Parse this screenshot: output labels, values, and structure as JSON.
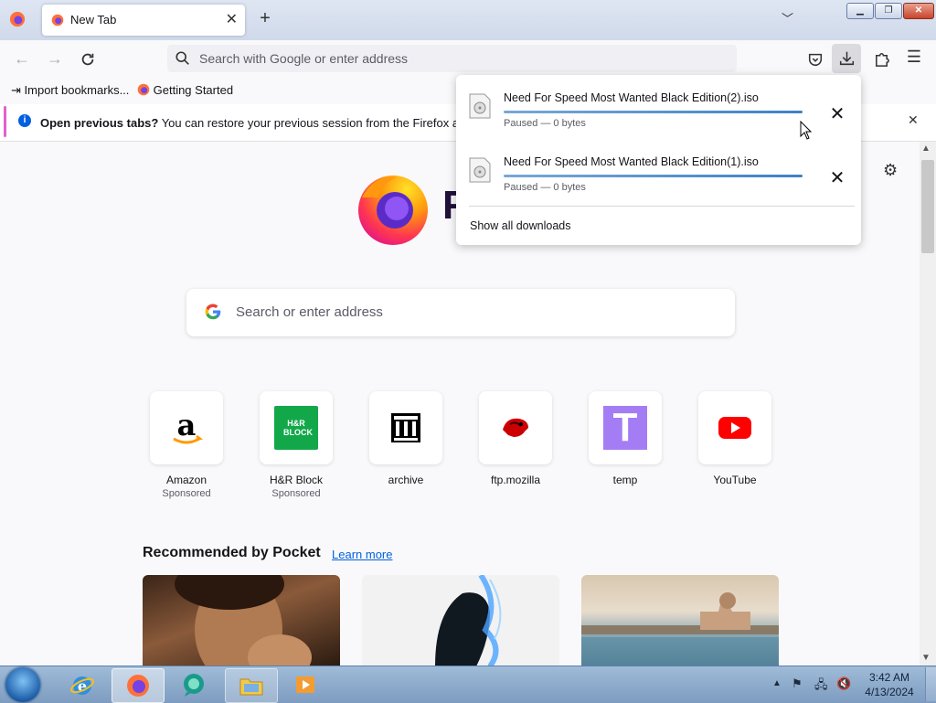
{
  "browser": {
    "tab": {
      "title": "New Tab"
    },
    "urlbar": {
      "placeholder": "Search with Google or enter address"
    },
    "bookmarks": [
      {
        "label": "Import bookmarks..."
      },
      {
        "label": "Getting Started"
      }
    ],
    "notification": {
      "bold": "Open previous tabs?",
      "text": " You can restore your previous session from the Firefox application"
    }
  },
  "downloads_panel": {
    "items": [
      {
        "name": "Need For Speed Most Wanted Black Edition(2).iso",
        "status": "Paused — 0 bytes",
        "progress": 1.0
      },
      {
        "name": "Need For Speed Most Wanted Black Edition(1).iso",
        "status": "Paused — 0 bytes",
        "progress": 1.0
      }
    ],
    "show_all": "Show all downloads"
  },
  "newtab": {
    "brand_partial": "F",
    "search_placeholder": "Search or enter address",
    "shortcuts": [
      {
        "label": "Amazon",
        "sponsored": "Sponsored",
        "icon": "amazon-icon"
      },
      {
        "label": "H&R Block",
        "sponsored": "Sponsored",
        "icon": "hr-block-icon",
        "icon_text": "H&R BLOCK"
      },
      {
        "label": "archive",
        "icon": "archive-icon"
      },
      {
        "label": "ftp.mozilla",
        "icon": "mozilla-icon"
      },
      {
        "label": "temp",
        "icon": "temp-icon",
        "icon_text": "T"
      },
      {
        "label": "YouTube",
        "icon": "youtube-icon"
      }
    ],
    "pocket": {
      "title": "Recommended by Pocket",
      "link": "Learn more"
    }
  },
  "taskbar": {
    "clock_time": "3:42 AM",
    "clock_date": "4/13/2024"
  },
  "colors": {
    "accent": "#0060df",
    "notification_accent": "#e15fcf",
    "hr_block_green": "#12a84a",
    "temp_purple": "#a47df5",
    "youtube_red": "#ff0000"
  }
}
